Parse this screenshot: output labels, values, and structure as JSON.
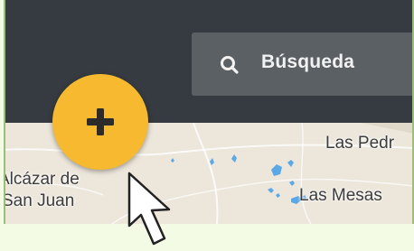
{
  "search": {
    "label": "Búsqueda",
    "icon": "search-icon"
  },
  "fab": {
    "icon": "plus-icon",
    "color": "#f6b92f"
  },
  "map": {
    "places": [
      {
        "name": "Las Pedr"
      },
      {
        "name": "Alcázar de"
      },
      {
        "name": "San Juan"
      },
      {
        "name": "Las Mesas"
      }
    ]
  },
  "colors": {
    "topbar": "#363b41",
    "search_box": "#5b6065",
    "map_land": "#ece6db",
    "water": "#5aa9e6",
    "page_background": "#f4fbe4"
  },
  "cursor": {
    "icon": "mouse-pointer-icon"
  }
}
